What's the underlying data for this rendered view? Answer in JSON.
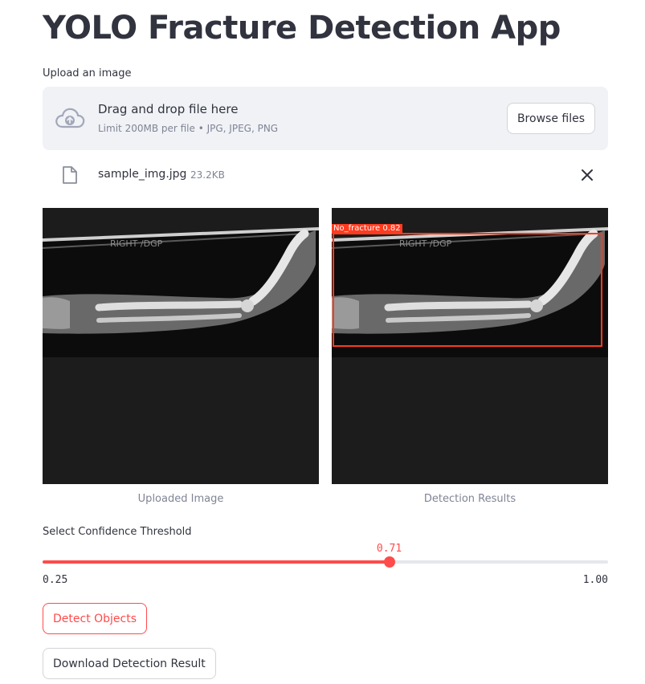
{
  "app": {
    "title": "YOLO Fracture Detection App"
  },
  "uploader": {
    "label": "Upload an image",
    "drop_text": "Drag and drop file here",
    "limit_text": "Limit 200MB per file • JPG, JPEG, PNG",
    "browse_label": "Browse files",
    "icon": "cloud-upload-icon"
  },
  "file": {
    "name": "sample_img.jpg",
    "size": "23.2KB",
    "icon": "file-icon",
    "remove_icon": "close-icon"
  },
  "images": {
    "left": {
      "image_text": "RIGHT /DGP",
      "caption": "Uploaded Image"
    },
    "right": {
      "image_text": "RIGHT /DGP",
      "caption": "Detection Results",
      "detection_label": "No_fracture 0.82"
    }
  },
  "slider": {
    "label": "Select Confidence Threshold",
    "value": "0.71",
    "min": "0.25",
    "max": "1.00",
    "fraction": 0.613
  },
  "buttons": {
    "detect": "Detect Objects",
    "download": "Download Detection Result"
  },
  "colors": {
    "accent": "#ff4b4b",
    "bbox": "#ff3b1f",
    "dropzone_bg": "#f0f2f6",
    "text": "#31333f",
    "muted": "#808495"
  }
}
